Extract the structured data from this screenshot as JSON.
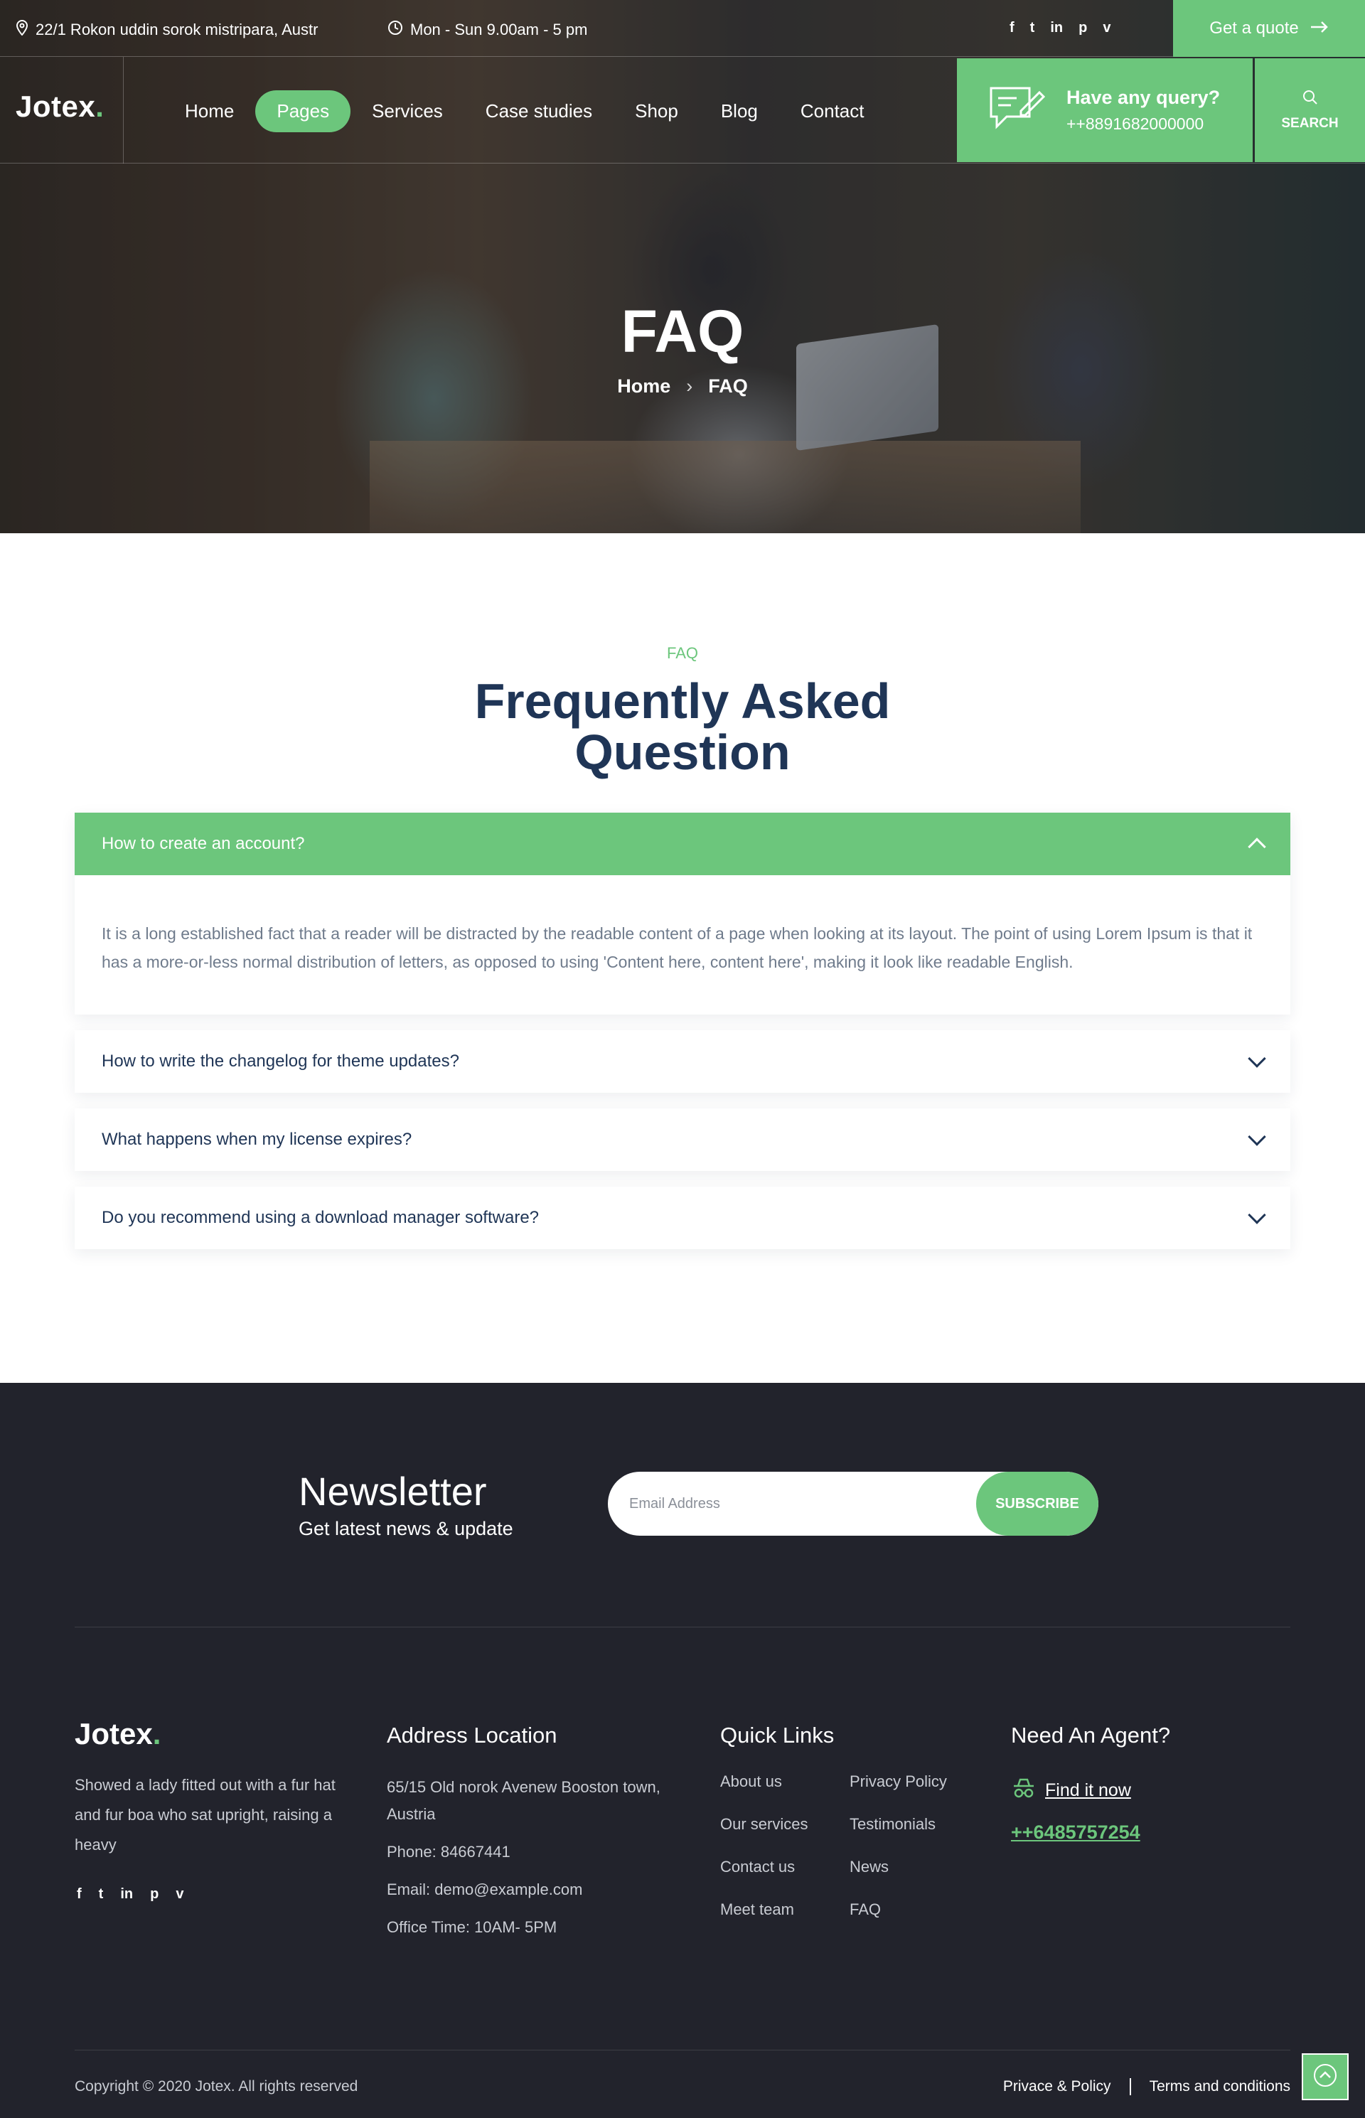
{
  "topbar": {
    "address": "22/1 Rokon uddin sorok mistripara, Austr",
    "hours": "Mon - Sun 9.00am - 5 pm",
    "socials": [
      "f",
      "t",
      "in",
      "p",
      "v"
    ],
    "quote_label": "Get a quote"
  },
  "nav": {
    "logo": "Jotex",
    "items": [
      "Home",
      "Pages",
      "Services",
      "Case studies",
      "Shop",
      "Blog",
      "Contact"
    ],
    "active": "Pages",
    "query_title": "Have any query?",
    "query_phone": "++8891682000000",
    "search_label": "SEARCH"
  },
  "hero": {
    "title": "FAQ",
    "breadcrumb": [
      "Home",
      "FAQ"
    ]
  },
  "faq": {
    "tag": "FAQ",
    "heading": "Frequently Asked Question",
    "items": [
      {
        "question": "How to create an account?",
        "answer": "It is a long established fact that a reader will be distracted by the readable content of a page when looking at its layout. The point of using Lorem Ipsum is that it has a more-or-less normal distribution of letters, as opposed to using 'Content here, content here', making it look like readable English."
      },
      {
        "question": "How to write the changelog for theme updates?"
      },
      {
        "question": "What happens when my license expires?"
      },
      {
        "question": "Do you recommend using a download manager software?"
      }
    ]
  },
  "newsletter": {
    "title": "Newsletter",
    "subtitle": "Get latest news & update",
    "placeholder": "Email Address",
    "button": "SUBSCRIBE"
  },
  "footer": {
    "logo": "Jotex",
    "about": "Showed a lady fitted out with a fur hat and fur boa who sat upright, raising a heavy",
    "address_title": "Address Location",
    "address": "65/15 Old norok Avenew Booston town, Austria",
    "phone": "Phone: 84667441",
    "email": "Email: demo@example.com",
    "office": "Office Time: 10AM- 5PM",
    "links_title": "Quick Links",
    "links_col1": [
      "About us",
      "Our services",
      "Contact us",
      "Meet team"
    ],
    "links_col2": [
      "Privacy Policy",
      "Testimonials",
      "News",
      "FAQ"
    ],
    "agent_title": "Need An Agent?",
    "agent_find": "Find it now",
    "agent_phone": "++6485757254",
    "copyright": "Copyright © 2020 Jotex. All rights reserved",
    "legal": [
      "Privace & Policy",
      "Terms and conditions"
    ]
  },
  "colors": {
    "accent": "#6cc67c",
    "navy": "#1f3556",
    "footer_bg": "#22232c"
  }
}
